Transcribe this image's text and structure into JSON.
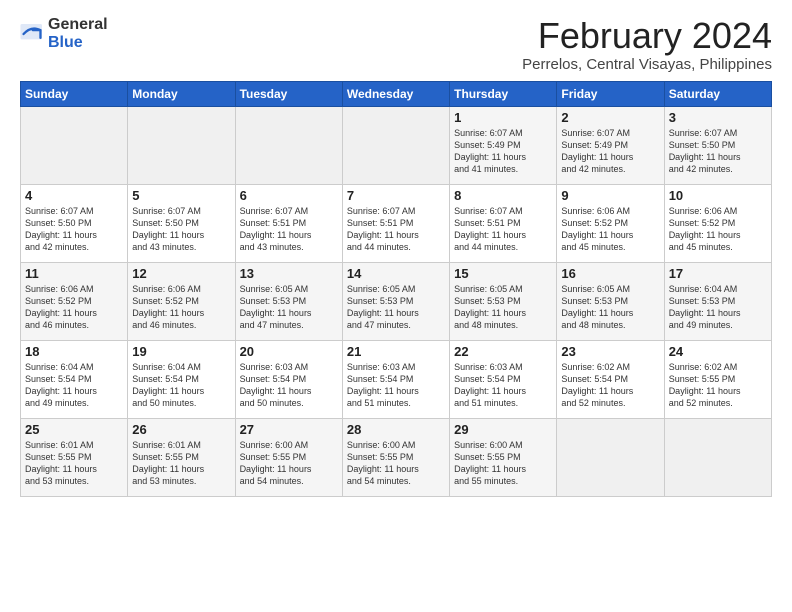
{
  "header": {
    "logo_general": "General",
    "logo_blue": "Blue",
    "title": "February 2024",
    "subtitle": "Perrelos, Central Visayas, Philippines"
  },
  "columns": [
    "Sunday",
    "Monday",
    "Tuesday",
    "Wednesday",
    "Thursday",
    "Friday",
    "Saturday"
  ],
  "weeks": [
    [
      {
        "day": "",
        "info": ""
      },
      {
        "day": "",
        "info": ""
      },
      {
        "day": "",
        "info": ""
      },
      {
        "day": "",
        "info": ""
      },
      {
        "day": "1",
        "info": "Sunrise: 6:07 AM\nSunset: 5:49 PM\nDaylight: 11 hours\nand 41 minutes."
      },
      {
        "day": "2",
        "info": "Sunrise: 6:07 AM\nSunset: 5:49 PM\nDaylight: 11 hours\nand 42 minutes."
      },
      {
        "day": "3",
        "info": "Sunrise: 6:07 AM\nSunset: 5:50 PM\nDaylight: 11 hours\nand 42 minutes."
      }
    ],
    [
      {
        "day": "4",
        "info": "Sunrise: 6:07 AM\nSunset: 5:50 PM\nDaylight: 11 hours\nand 42 minutes."
      },
      {
        "day": "5",
        "info": "Sunrise: 6:07 AM\nSunset: 5:50 PM\nDaylight: 11 hours\nand 43 minutes."
      },
      {
        "day": "6",
        "info": "Sunrise: 6:07 AM\nSunset: 5:51 PM\nDaylight: 11 hours\nand 43 minutes."
      },
      {
        "day": "7",
        "info": "Sunrise: 6:07 AM\nSunset: 5:51 PM\nDaylight: 11 hours\nand 44 minutes."
      },
      {
        "day": "8",
        "info": "Sunrise: 6:07 AM\nSunset: 5:51 PM\nDaylight: 11 hours\nand 44 minutes."
      },
      {
        "day": "9",
        "info": "Sunrise: 6:06 AM\nSunset: 5:52 PM\nDaylight: 11 hours\nand 45 minutes."
      },
      {
        "day": "10",
        "info": "Sunrise: 6:06 AM\nSunset: 5:52 PM\nDaylight: 11 hours\nand 45 minutes."
      }
    ],
    [
      {
        "day": "11",
        "info": "Sunrise: 6:06 AM\nSunset: 5:52 PM\nDaylight: 11 hours\nand 46 minutes."
      },
      {
        "day": "12",
        "info": "Sunrise: 6:06 AM\nSunset: 5:52 PM\nDaylight: 11 hours\nand 46 minutes."
      },
      {
        "day": "13",
        "info": "Sunrise: 6:05 AM\nSunset: 5:53 PM\nDaylight: 11 hours\nand 47 minutes."
      },
      {
        "day": "14",
        "info": "Sunrise: 6:05 AM\nSunset: 5:53 PM\nDaylight: 11 hours\nand 47 minutes."
      },
      {
        "day": "15",
        "info": "Sunrise: 6:05 AM\nSunset: 5:53 PM\nDaylight: 11 hours\nand 48 minutes."
      },
      {
        "day": "16",
        "info": "Sunrise: 6:05 AM\nSunset: 5:53 PM\nDaylight: 11 hours\nand 48 minutes."
      },
      {
        "day": "17",
        "info": "Sunrise: 6:04 AM\nSunset: 5:53 PM\nDaylight: 11 hours\nand 49 minutes."
      }
    ],
    [
      {
        "day": "18",
        "info": "Sunrise: 6:04 AM\nSunset: 5:54 PM\nDaylight: 11 hours\nand 49 minutes."
      },
      {
        "day": "19",
        "info": "Sunrise: 6:04 AM\nSunset: 5:54 PM\nDaylight: 11 hours\nand 50 minutes."
      },
      {
        "day": "20",
        "info": "Sunrise: 6:03 AM\nSunset: 5:54 PM\nDaylight: 11 hours\nand 50 minutes."
      },
      {
        "day": "21",
        "info": "Sunrise: 6:03 AM\nSunset: 5:54 PM\nDaylight: 11 hours\nand 51 minutes."
      },
      {
        "day": "22",
        "info": "Sunrise: 6:03 AM\nSunset: 5:54 PM\nDaylight: 11 hours\nand 51 minutes."
      },
      {
        "day": "23",
        "info": "Sunrise: 6:02 AM\nSunset: 5:54 PM\nDaylight: 11 hours\nand 52 minutes."
      },
      {
        "day": "24",
        "info": "Sunrise: 6:02 AM\nSunset: 5:55 PM\nDaylight: 11 hours\nand 52 minutes."
      }
    ],
    [
      {
        "day": "25",
        "info": "Sunrise: 6:01 AM\nSunset: 5:55 PM\nDaylight: 11 hours\nand 53 minutes."
      },
      {
        "day": "26",
        "info": "Sunrise: 6:01 AM\nSunset: 5:55 PM\nDaylight: 11 hours\nand 53 minutes."
      },
      {
        "day": "27",
        "info": "Sunrise: 6:00 AM\nSunset: 5:55 PM\nDaylight: 11 hours\nand 54 minutes."
      },
      {
        "day": "28",
        "info": "Sunrise: 6:00 AM\nSunset: 5:55 PM\nDaylight: 11 hours\nand 54 minutes."
      },
      {
        "day": "29",
        "info": "Sunrise: 6:00 AM\nSunset: 5:55 PM\nDaylight: 11 hours\nand 55 minutes."
      },
      {
        "day": "",
        "info": ""
      },
      {
        "day": "",
        "info": ""
      }
    ]
  ]
}
